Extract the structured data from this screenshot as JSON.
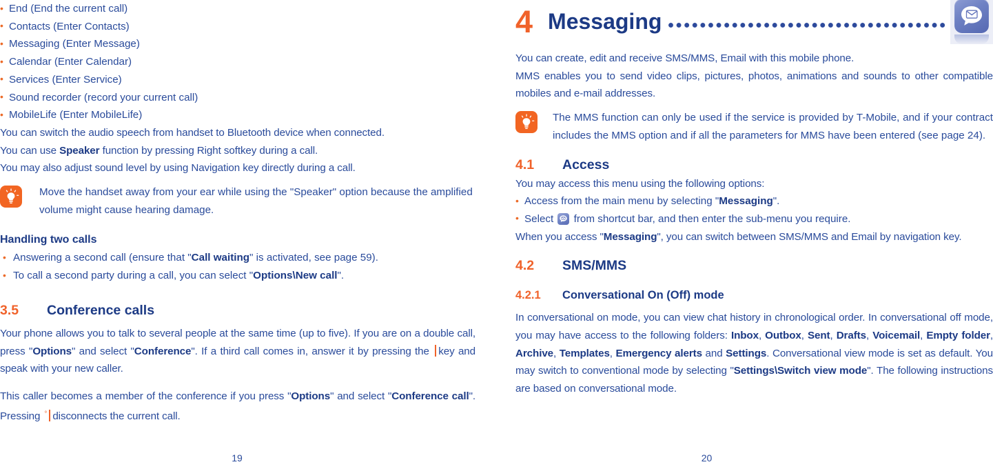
{
  "document": {
    "title": "Mobile phone user manual spread",
    "accent_orange": "#f0622a",
    "text_blue": "#2a4b9b",
    "bold_blue": "#1c3a85"
  },
  "left_page": {
    "folio": "19",
    "in_call_options": [
      "End (End the current call)",
      "Contacts (Enter Contacts)",
      "Messaging (Enter Message)",
      "Calendar (Enter Calendar)",
      "Services (Enter Service)",
      "Sound recorder (record your current call)",
      "MobileLife (Enter MobileLife)"
    ],
    "paragraphs": {
      "bluetooth": "You can switch the audio speech from handset to Bluetooth device when connected.",
      "speaker_pre": "You can use ",
      "speaker_bold": "Speaker",
      "speaker_post": " function by pressing Right softkey during a call.",
      "volume": "You may also adjust sound level by using Navigation key directly during a call."
    },
    "tip": {
      "icon": "lightbulb-tip-icon",
      "text": "Move the handset away from your ear while using the \"Speaker\" option because the amplified volume might cause hearing damage."
    },
    "handling": {
      "heading": "Handling two calls",
      "bullet1_pre": "Answering a second call (ensure that \"",
      "bullet1_bold": "Call waiting",
      "bullet1_post": "\" is activated, see page 59).",
      "bullet2_pre": "To call a second party during a call, you can select \"",
      "bullet2_bold": "Options\\New call",
      "bullet2_post": "\"."
    },
    "conference": {
      "number": "3.5",
      "title": "Conference calls",
      "p1_a": "Your phone allows you to talk to several people at the same time (up to five). If you are on a double call, press \"",
      "p1_b": "Options",
      "p1_c": "\" and select \"",
      "p1_d": "Conference",
      "p1_e": "\". If a third call comes in, answer it by pressing the ",
      "p1_f": "key and speak with your new caller.",
      "p2_a": "This caller becomes a member of the conference if you press \"",
      "p2_b": "Options",
      "p2_c": "\" and select \"",
      "p2_d": "Conference call",
      "p2_e": "\". Pressing ",
      "p2_f": "disconnects the current call."
    }
  },
  "right_page": {
    "folio": "20",
    "chapter": {
      "number": "4",
      "title": "Messaging",
      "icon": "messaging-app-icon"
    },
    "intro": {
      "line1": "You can create, edit and receive SMS/MMS, Email with this mobile phone.",
      "line2": "MMS enables you to send video clips, pictures, photos, animations and sounds to other compatible mobiles and e-mail addresses."
    },
    "tip": {
      "icon": "lightbulb-tip-icon",
      "text": "The MMS function can only be used if the service is provided by T-Mobile, and if your contract includes the MMS option and if all the parameters for MMS have been entered (see page 24)."
    },
    "access": {
      "number": "4.1",
      "title": "Access",
      "lead": "You may access this menu using the following options:",
      "bullet1_pre": "Access from the main menu by selecting \"",
      "bullet1_bold": "Messaging",
      "bullet1_post": "\".",
      "bullet2_pre": "Select ",
      "bullet2_post": " from shortcut bar, and then enter the sub-menu you require.",
      "closing_pre": "When you access \"",
      "closing_bold": "Messaging",
      "closing_post": "\", you can switch between SMS/MMS and Email by navigation key."
    },
    "smsmms": {
      "number": "4.2",
      "title": "SMS/MMS",
      "sub_number": "4.2.1",
      "sub_title": "Conversational On (Off) mode",
      "para_a": "In conversational on mode, you can view chat history in chronological order. In conversational off mode, you may have access to the following folders: ",
      "folders": [
        "Inbox",
        "Outbox",
        "Sent",
        "Drafts",
        "Voicemail",
        "Empty folder",
        "Archive",
        "Templates",
        "Emergency alerts"
      ],
      "para_b": " and ",
      "folder_last": "Settings",
      "para_c": ". Conversational view mode is set as default. You may switch to conventional mode by selecting \"",
      "para_d": "Settings\\Switch view mode",
      "para_e": "\". The following instructions are based on conversational mode."
    }
  }
}
